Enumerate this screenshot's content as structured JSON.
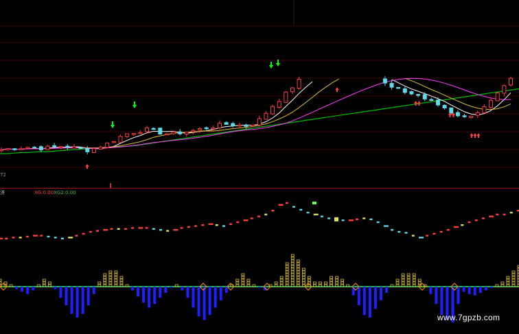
{
  "colors": {
    "background": "#000000",
    "grid": "#3a0000",
    "separator": "#a01010",
    "candle_up": "#ff4040",
    "candle_down": "#60d8e8",
    "ma5": "#ffffff",
    "ma10": "#e0c040",
    "ma20": "#ff40ff",
    "ma60": "#00c000",
    "buy_arrow": "#00ff00",
    "sell_marker": "#ff4040",
    "zero_line": "#30ff60",
    "osc_up": "#e0c040",
    "osc_down": "#2020ff",
    "diamond": "#ff9000"
  },
  "labels": {
    "indicator_name": "济",
    "xg": "XG:0.00",
    "xg2": "XG2:0.00",
    "scale_value": "72"
  },
  "watermark": "www.7gpzb.com",
  "icons": [
    "buy-arrow-icon",
    "sell-marker-icon",
    "diamond-icon"
  ],
  "chart_data": {
    "type": "candlestick",
    "main_panel": {
      "ma60": [
        222,
        222,
        223,
        224,
        224,
        225,
        226,
        226,
        227,
        228,
        229,
        230,
        231,
        232,
        233,
        234,
        235,
        236,
        236,
        237,
        238,
        240,
        242,
        244,
        246,
        248,
        250,
        252,
        254,
        256,
        258,
        260,
        262,
        264,
        266,
        268,
        270,
        272,
        274,
        276,
        278,
        280,
        282,
        284,
        286,
        288,
        290,
        292,
        294,
        296,
        298,
        300,
        302,
        304,
        306,
        308,
        310,
        312,
        314,
        316,
        318,
        320,
        322,
        324,
        326,
        328,
        330,
        332,
        334,
        336,
        338,
        340,
        342,
        344,
        346,
        348,
        350,
        352
      ],
      "price_trend": [
        230,
        232,
        233,
        234,
        235,
        234,
        233,
        234,
        236,
        237,
        236,
        234,
        231,
        229,
        232,
        237,
        242,
        249,
        256,
        262,
        265,
        268,
        270,
        268,
        264,
        262,
        262,
        264,
        266,
        268,
        271,
        274,
        276,
        279,
        281,
        280,
        279,
        278,
        282,
        290,
        304,
        318,
        330,
        342,
        356,
        368,
        378,
        384,
        386,
        388,
        390,
        392,
        394,
        396,
        394,
        390,
        380,
        372,
        362,
        354,
        350,
        346,
        342,
        340,
        332,
        326,
        320,
        314,
        305,
        300,
        294,
        300,
        306,
        314,
        326,
        340,
        355,
        370
      ]
    },
    "secondary_panel": {
      "values": [
        3,
        3,
        4,
        4,
        5,
        6,
        6,
        5,
        4,
        3,
        4,
        6,
        8,
        10,
        11,
        12,
        13,
        13,
        13,
        14,
        14,
        14,
        13,
        12,
        11,
        12,
        14,
        15,
        16,
        17,
        18,
        17,
        16,
        18,
        20,
        22,
        24,
        26,
        28,
        32,
        38,
        40,
        36,
        33,
        30,
        28,
        26,
        24,
        23,
        22,
        22,
        23,
        24,
        23,
        20,
        16,
        12,
        10,
        9,
        6,
        4,
        6,
        8,
        10,
        12,
        15,
        17,
        20,
        22,
        24,
        26,
        28,
        28,
        30,
        32
      ]
    },
    "oscillator_panel": {
      "values": [
        12,
        10,
        2,
        -4,
        -8,
        -12,
        -6,
        6,
        14,
        10,
        -4,
        -18,
        -30,
        -44,
        -50,
        -44,
        -30,
        -12,
        10,
        24,
        28,
        26,
        18,
        6,
        -6,
        -16,
        -26,
        -34,
        -28,
        -18,
        -10,
        -2,
        2,
        -6,
        -18,
        -34,
        -48,
        -54,
        -46,
        -34,
        -22,
        -10,
        2,
        12,
        22,
        12,
        4,
        -2,
        -6,
        0,
        8,
        18,
        40,
        54,
        46,
        30,
        18,
        10,
        8,
        10,
        16,
        18,
        14,
        2,
        -14,
        -30,
        -46,
        -50,
        -36,
        -22,
        -10,
        4,
        14,
        20,
        22,
        24,
        14,
        2,
        -12,
        -28,
        -46,
        -54,
        -58,
        -28,
        -8,
        -12,
        -14,
        -10,
        -6,
        -2,
        4,
        10,
        18,
        26,
        34
      ]
    }
  }
}
